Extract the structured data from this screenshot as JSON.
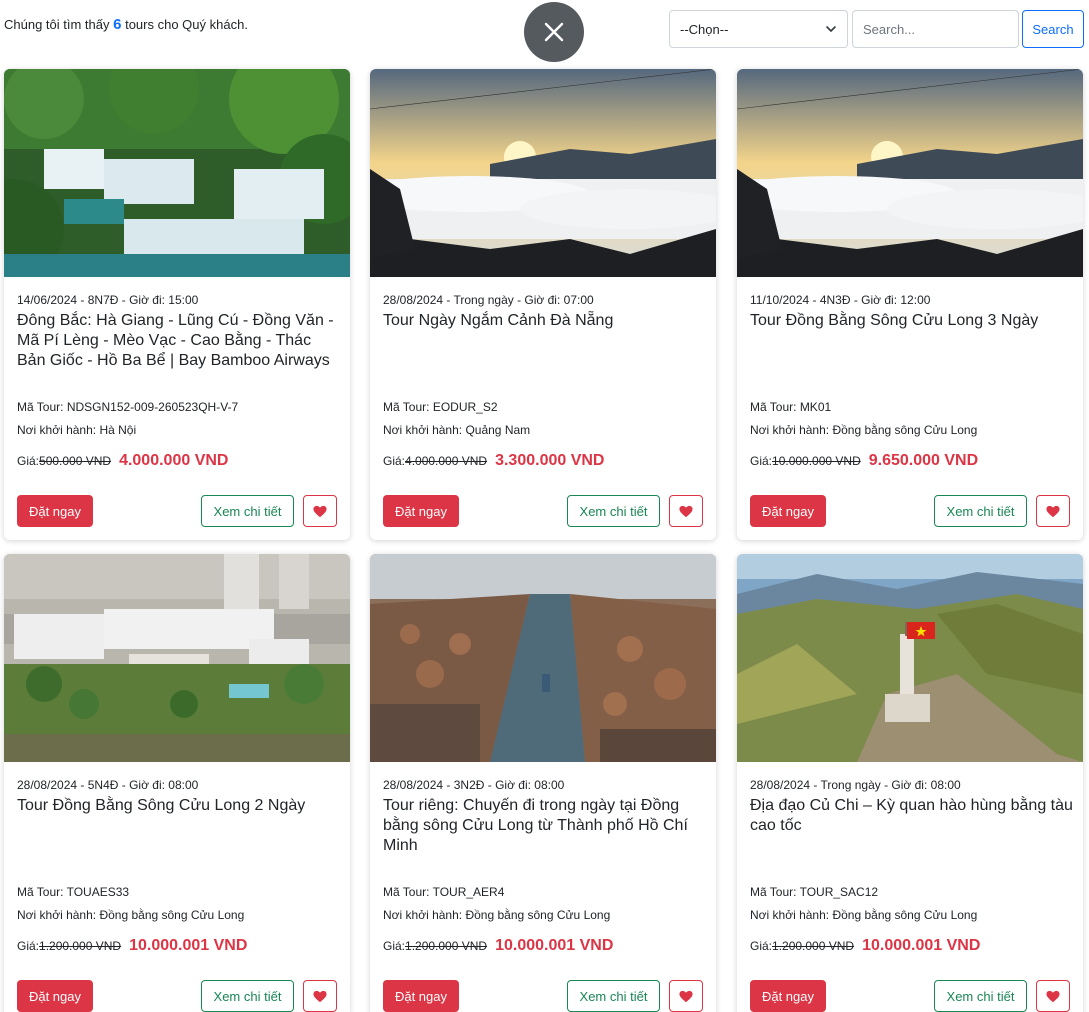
{
  "header": {
    "result_prefix": "Chúng tôi tìm thấy",
    "result_count": "6",
    "result_suffix": "tours cho Quý khách.",
    "select_value": "--Chọn--",
    "search_placeholder": "Search...",
    "search_button": "Search"
  },
  "labels": {
    "code_prefix": "Mã Tour:",
    "origin_prefix": "Nơi khởi hành:",
    "price_prefix": "Giá:",
    "book_button": "Đặt ngay",
    "detail_button": "Xem chi tiết"
  },
  "colors": {
    "accent_blue": "#0d6efd",
    "price_red": "#dc3545",
    "detail_green": "#198754"
  },
  "tours": [
    {
      "meta": "14/06/2024 - 8N7Đ - Giờ đi: 15:00",
      "title": "Đông Bắc: Hà Giang - Lũng Cú - Đồng Văn - Mã Pí Lèng - Mèo Vạc - Cao Bằng - Thác Bản Giốc - Hồ Ba Bể | Bay Bamboo Airways",
      "code": "NDSGN152-009-260523QH-V-7",
      "origin": "Hà Nội",
      "old_price": "500.000 VND",
      "new_price": "4.000.000 VND",
      "image": "waterfall"
    },
    {
      "meta": "28/08/2024 - Trong ngày - Giờ đi: 07:00",
      "title": "Tour Ngày Ngắm Cảnh Đà Nẵng",
      "code": "EODUR_S2",
      "origin": "Quảng Nam",
      "old_price": "4.000.000 VND",
      "new_price": "3.300.000 VND",
      "image": "sunrise-clouds"
    },
    {
      "meta": "11/10/2024 - 4N3Đ - Giờ đi: 12:00",
      "title": "Tour Đồng Bằng Sông Cửu Long 3 Ngày",
      "code": "MK01",
      "origin": "Đồng bằng sông Cửu Long",
      "old_price": "10.000.000 VND",
      "new_price": "9.650.000 VND",
      "image": "sunrise-clouds"
    },
    {
      "meta": "28/08/2024 - 5N4Đ - Giờ đi: 08:00",
      "title": "Tour Đồng Bằng Sông Cửu Long 2 Ngày",
      "code": "TOUAES33",
      "origin": "Đồng bằng sông Cửu Long",
      "old_price": "1.200.000 VND",
      "new_price": "10.000.001 VND",
      "image": "hotel-aerial"
    },
    {
      "meta": "28/08/2024 - 3N2Đ - Giờ đi: 08:00",
      "title": "Tour riêng: Chuyến đi trong ngày tại Đồng bằng sông Cửu Long từ Thành phố Hồ Chí Minh",
      "code": "TOUR_AER4",
      "origin": "Đồng bằng sông Cửu Long",
      "old_price": "1.200.000 VND",
      "new_price": "10.000.001 VND",
      "image": "river-kilns"
    },
    {
      "meta": "28/08/2024 - Trong ngày - Giờ đi: 08:00",
      "title": "Địa đạo Củ Chi – Kỳ quan hào hùng bằng tàu cao tốc",
      "code": "TOUR_SAC12",
      "origin": "Đồng bằng sông Cửu Long",
      "old_price": "1.200.000 VND",
      "new_price": "10.000.001 VND",
      "image": "flag-tower"
    }
  ]
}
